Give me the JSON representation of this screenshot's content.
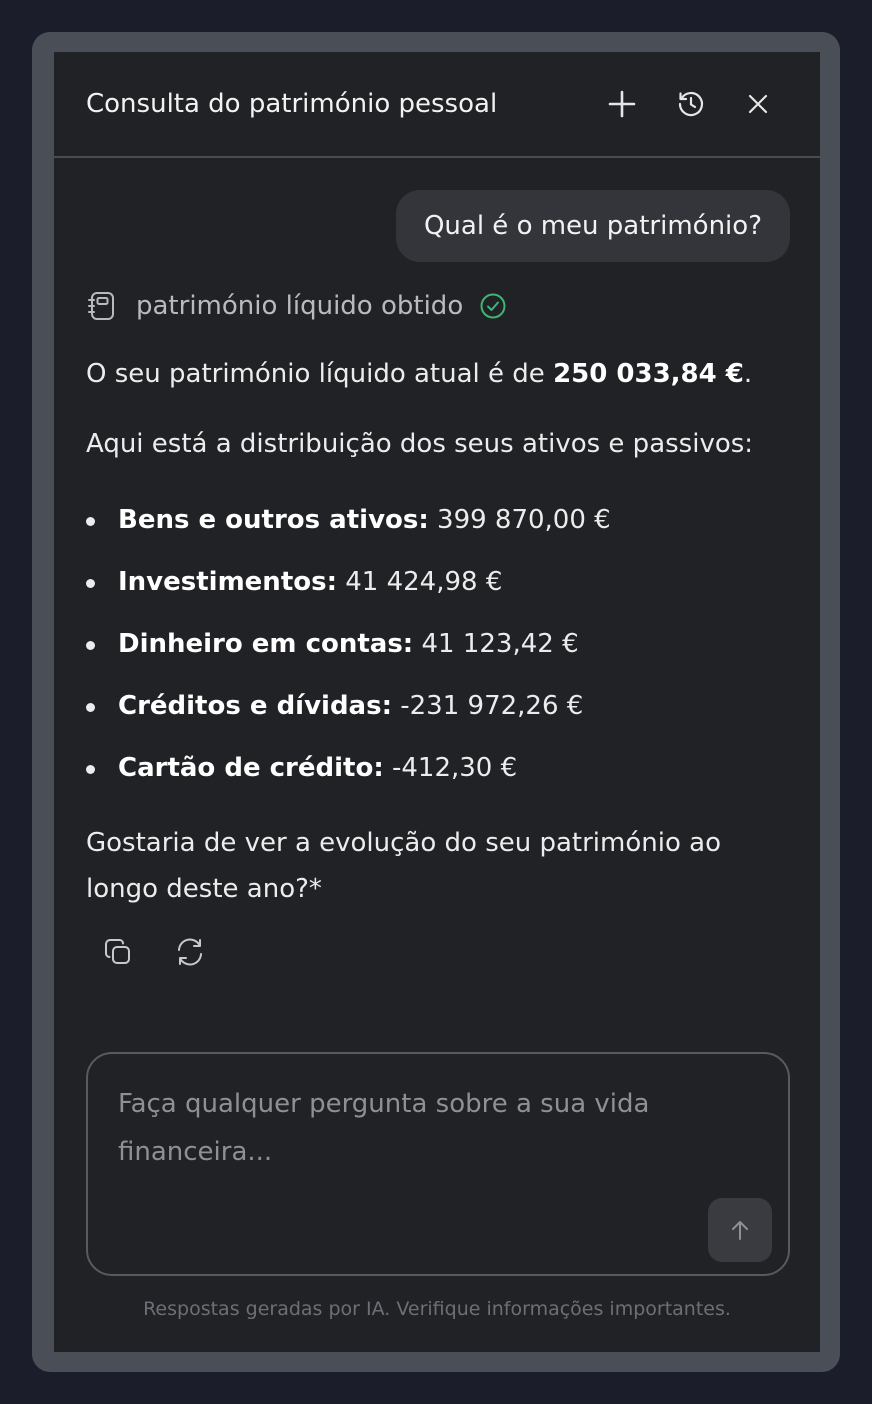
{
  "header": {
    "title": "Consulta do património pessoal",
    "new_chat_icon": "plus-icon",
    "history_icon": "history-icon",
    "close_icon": "close-icon"
  },
  "user_message": "Qual é o meu património?",
  "tool_call": {
    "icon": "notebook-icon",
    "label": "património líquido obtido",
    "status_icon": "check-circle-icon",
    "status_color": "#3fb574"
  },
  "assistant": {
    "net_worth_prefix": "O seu património líquido atual é de ",
    "net_worth_value": "250 033,84 €",
    "net_worth_suffix": ".",
    "intro": "Aqui está a distribuição dos seus ativos e passivos:",
    "items": [
      {
        "label": "Bens e outros ativos:",
        "value": " 399 870,00 €"
      },
      {
        "label": "Investimentos:",
        "value": " 41 424,98 €"
      },
      {
        "label": "Dinheiro em contas:",
        "value": " 41 123,42 €"
      },
      {
        "label": "Créditos e dívidas:",
        "value": " -231 972,26 €"
      },
      {
        "label": "Cartão de crédito:",
        "value": " -412,30 €"
      }
    ],
    "question": "Gostaria de ver a evolução do seu património ao longo deste ano?*"
  },
  "actions": {
    "copy_icon": "copy-icon",
    "regenerate_icon": "refresh-icon"
  },
  "composer": {
    "value": "",
    "placeholder": "Faça qualquer pergunta sobre a sua vida financeira...",
    "send_icon": "arrow-up-icon"
  },
  "footer": {
    "disclaimer": "Respostas geradas por IA. Verifique informações importantes."
  }
}
